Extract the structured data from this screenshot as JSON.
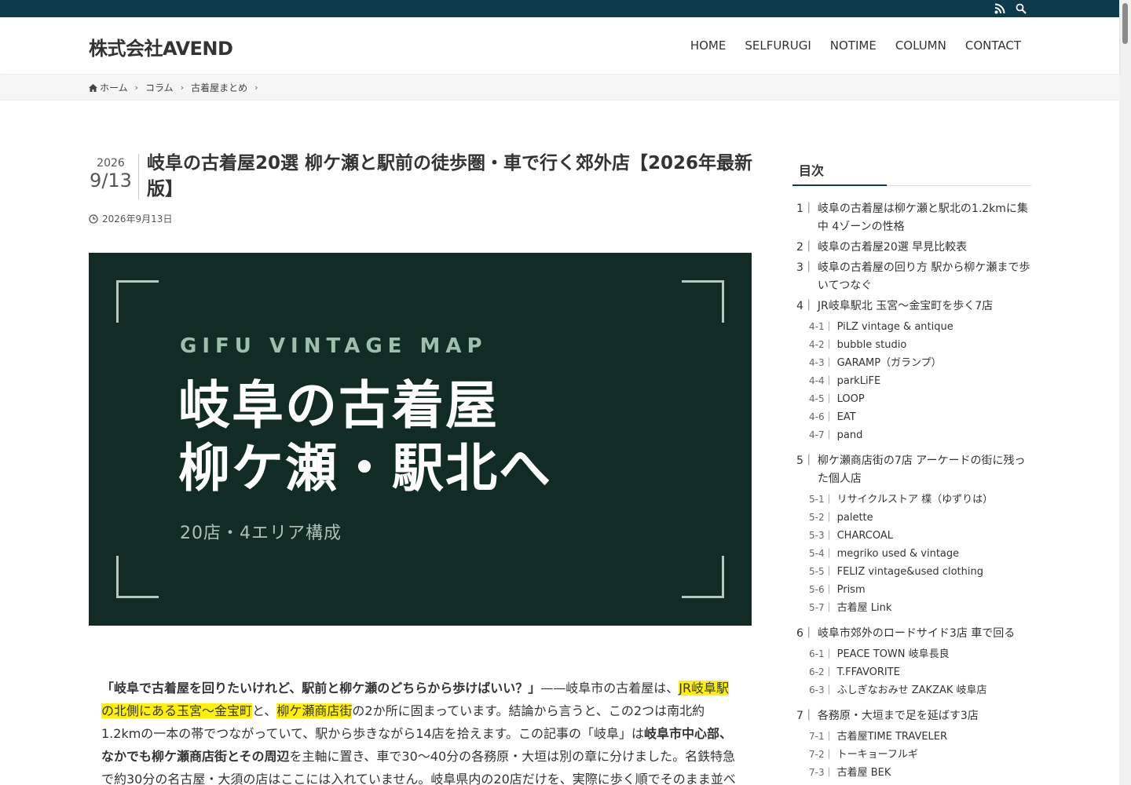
{
  "topbar": {
    "icons": [
      "rss-icon",
      "search-icon"
    ]
  },
  "header": {
    "site_title": "株式会社AVEND",
    "nav": [
      "HOME",
      "SELFURUGI",
      "NOTIME",
      "COLUMN",
      "CONTACT"
    ]
  },
  "breadcrumb": {
    "items": [
      "ホーム",
      "コラム",
      "古着屋まとめ"
    ]
  },
  "article": {
    "date_year": "2026",
    "date_md": "9/13",
    "title": "岐阜の古着屋20選 柳ケ瀬と駅前の徒歩圏・車で行く郊外店【2026年最新版】",
    "published": "2026年9月13日"
  },
  "hero": {
    "kicker": "GIFU VINTAGE MAP",
    "heading_line1": "岐阜の古着屋",
    "heading_line2": "柳ケ瀬・駅北へ",
    "sub": "20店・4エリア構成"
  },
  "intro": {
    "p1": "「岐阜で古着屋を回りたいけれど、駅前と柳ケ瀬のどちらから歩けばいい？」",
    "p2": "——岐阜市の古着屋は、",
    "hl1": "JR岐阜駅の北側にある玉宮〜金宝町",
    "p3": "と、",
    "hl2": "柳ケ瀬商店街",
    "p4": "の2か所に固まっています。結論から言うと、この2つは南北約1.2kmの一本の帯でつながっていて、駅から歩きながら14店を拾えます。この記事の「岐阜」は",
    "b1": "岐阜市中心部、なかでも柳ケ瀬商店街とその周辺",
    "p5": "を主軸に置き、車で30〜40分の各務原・大垣は別の章に分けました。名鉄特急で約30分の名古屋・大須の店はここには入れていません。岐阜県内の20店だけを、実際に歩く順でそのまま並べていま"
  },
  "toc": {
    "heading": "目次",
    "items": [
      {
        "num": "1｜",
        "label": "岐阜の古着屋は柳ケ瀬と駅北の1.2kmに集中 4ゾーンの性格",
        "subs": []
      },
      {
        "num": "2｜",
        "label": "岐阜の古着屋20選 早見比較表",
        "subs": []
      },
      {
        "num": "3｜",
        "label": "岐阜の古着屋の回り方 駅から柳ケ瀬まで歩いてつなぐ",
        "subs": []
      },
      {
        "num": "4｜",
        "label": "JR岐阜駅北 玉宮〜金宝町を歩く7店",
        "subs": [
          {
            "num": "4-1｜",
            "label": "PiLZ vintage & antique"
          },
          {
            "num": "4-2｜",
            "label": "bubble studio"
          },
          {
            "num": "4-3｜",
            "label": "GARAMP（ガランプ）"
          },
          {
            "num": "4-4｜",
            "label": "parkLiFE"
          },
          {
            "num": "4-5｜",
            "label": "LOOP"
          },
          {
            "num": "4-6｜",
            "label": "EAT"
          },
          {
            "num": "4-7｜",
            "label": "pand"
          }
        ]
      },
      {
        "num": "5｜",
        "label": "柳ケ瀬商店街の7店 アーケードの街に残った個人店",
        "subs": [
          {
            "num": "5-1｜",
            "label": "リサイクルストア 楪（ゆずりは）"
          },
          {
            "num": "5-2｜",
            "label": "palette"
          },
          {
            "num": "5-3｜",
            "label": "CHARCOAL"
          },
          {
            "num": "5-4｜",
            "label": "megriko used & vintage"
          },
          {
            "num": "5-5｜",
            "label": "FELIZ vintage&used clothing"
          },
          {
            "num": "5-6｜",
            "label": "Prism"
          },
          {
            "num": "5-7｜",
            "label": "古着屋 Link"
          }
        ]
      },
      {
        "num": "6｜",
        "label": "岐阜市郊外のロードサイド3店 車で回る",
        "subs": [
          {
            "num": "6-1｜",
            "label": "PEACE TOWN 岐阜長良"
          },
          {
            "num": "6-2｜",
            "label": "T.FFAVORITE"
          },
          {
            "num": "6-3｜",
            "label": "ふしぎなおみせ ZAKZAK 岐阜店"
          }
        ]
      },
      {
        "num": "7｜",
        "label": "各務原・大垣まで足を延ばす3店",
        "subs": [
          {
            "num": "7-1｜",
            "label": "古着屋TIME TRAVELER"
          },
          {
            "num": "7-2｜",
            "label": "トーキョーフルギ"
          },
          {
            "num": "7-3｜",
            "label": "古着屋 BEK"
          }
        ]
      }
    ]
  }
}
